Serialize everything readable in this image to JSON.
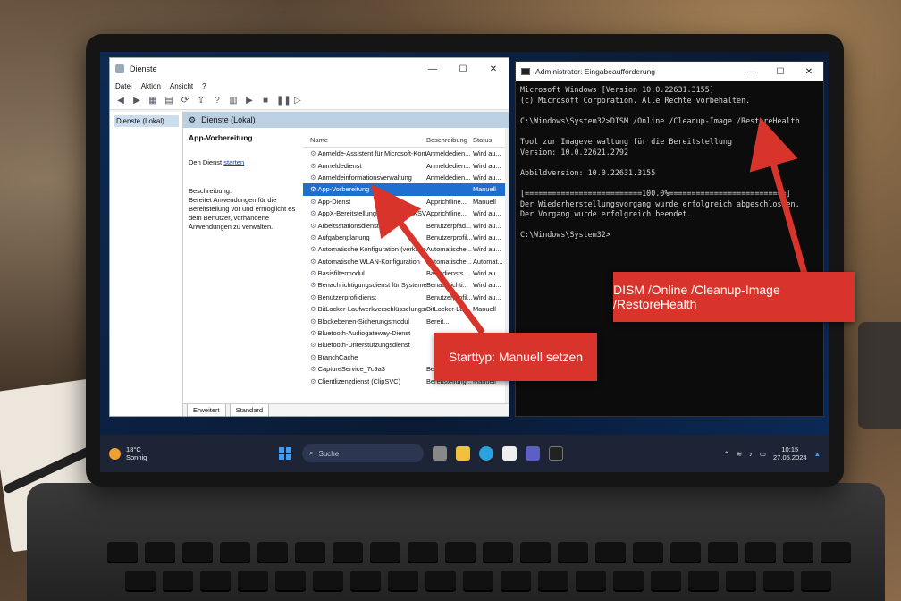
{
  "services_window": {
    "title": "Dienste",
    "menu": [
      "Datei",
      "Aktion",
      "Ansicht",
      "?"
    ],
    "tree_item": "Dienste (Lokal)",
    "pane_header": "Dienste (Lokal)",
    "detail_title": "App-Vorbereitung",
    "detail_action_prefix": "Den Dienst ",
    "detail_action_link": "starten",
    "description_label": "Beschreibung:",
    "description_text": "Bereitet Anwendungen für die Bereitstellung vor und ermöglicht es dem Benutzer, vorhandene Anwendungen zu verwalten.",
    "columns": {
      "name": "Name",
      "description": "Beschreibung",
      "status": "Status"
    },
    "services": [
      {
        "name": "Anmelde-Assistent für Microsoft-Konto",
        "desc": "Anmeldedien...",
        "status": "Wird au..."
      },
      {
        "name": "Anmeldedienst",
        "desc": "Anmeldedien...",
        "status": "Wird au..."
      },
      {
        "name": "Anmeldeinformationsverwaltung",
        "desc": "Anmeldedien...",
        "status": "Wird au..."
      },
      {
        "name": "App-Vorbereitung",
        "desc": "",
        "status": "Manuell"
      },
      {
        "name": "App-Dienst",
        "desc": "Apprichtline...",
        "status": "Manuell"
      },
      {
        "name": "AppX-Bereitstellungsdienst (AppXSVC)",
        "desc": "Apprichtline...",
        "status": "Wird au..."
      },
      {
        "name": "Arbeitsstationsdienst",
        "desc": "Benutzerpfad...",
        "status": "Wird au..."
      },
      {
        "name": "Aufgabenplanung",
        "desc": "Benutzerprofil...",
        "status": "Wird au..."
      },
      {
        "name": "Automatische Konfiguration (verkabelt)",
        "desc": "Automatische...",
        "status": "Wird au..."
      },
      {
        "name": "Automatische WLAN-Konfiguration",
        "desc": "Automatische...",
        "status": "Automat..."
      },
      {
        "name": "Basisfiltermodul",
        "desc": "Basisdiensts...",
        "status": "Wird au..."
      },
      {
        "name": "Benachrichtigungsdienst für Systemereignisse",
        "desc": "Benachrichti...",
        "status": "Wird au..."
      },
      {
        "name": "Benutzerprofildienst",
        "desc": "Benutzerprofil...",
        "status": "Wird au..."
      },
      {
        "name": "BitLocker-Laufwerkverschlüsselungsdienst",
        "desc": "BitLocker-La...",
        "status": "Manuell"
      },
      {
        "name": "Blockebenen-Sicherungsmodul",
        "desc": "Bereit...",
        "status": ""
      },
      {
        "name": "Bluetooth-Audiogateway-Dienst",
        "desc": "",
        "status": ""
      },
      {
        "name": "Bluetooth-Unterstützungsdienst",
        "desc": "",
        "status": ""
      },
      {
        "name": "BranchCache",
        "desc": "",
        "status": ""
      },
      {
        "name": "CaptureService_7c9a3",
        "desc": "Bereitet Inh...",
        "status": "Manuell"
      },
      {
        "name": "Clientlizenzdienst (ClipSVC)",
        "desc": "Bereitstellung...",
        "status": "Manuell"
      }
    ],
    "tabs": [
      "Erweitert",
      "Standard"
    ]
  },
  "cmd_window": {
    "title": "Administrator: Eingabeaufforderung",
    "lines": [
      "Microsoft Windows [Version 10.0.22631.3155]",
      "(c) Microsoft Corporation. Alle Rechte vorbehalten.",
      "",
      "C:\\Windows\\System32>DISM /Online /Cleanup-Image /RestoreHealth",
      "",
      "Tool zur Imageverwaltung für die Bereitstellung",
      "Version: 10.0.22621.2792",
      "",
      "Abbildversion: 10.0.22631.3155",
      "",
      "[==========================100.0%==========================]",
      "Der Wiederherstellungsvorgang wurde erfolgreich abgeschlossen.",
      "Der Vorgang wurde erfolgreich beendet.",
      "",
      "C:\\Windows\\System32>"
    ]
  },
  "taskbar": {
    "temperature": "18°C",
    "weather": "Sonnig",
    "search_placeholder": "Suche",
    "time": "10:15",
    "date": "27.05.2024"
  },
  "annotations": {
    "starttyp": "Starttyp: Manuell setzen",
    "dism": "DISM /Online /Cleanup-Image /RestoreHealth"
  },
  "colors": {
    "selection": "#1e6fd0",
    "callout": "#d9342b",
    "terminal_bg": "#0c0c0c"
  }
}
